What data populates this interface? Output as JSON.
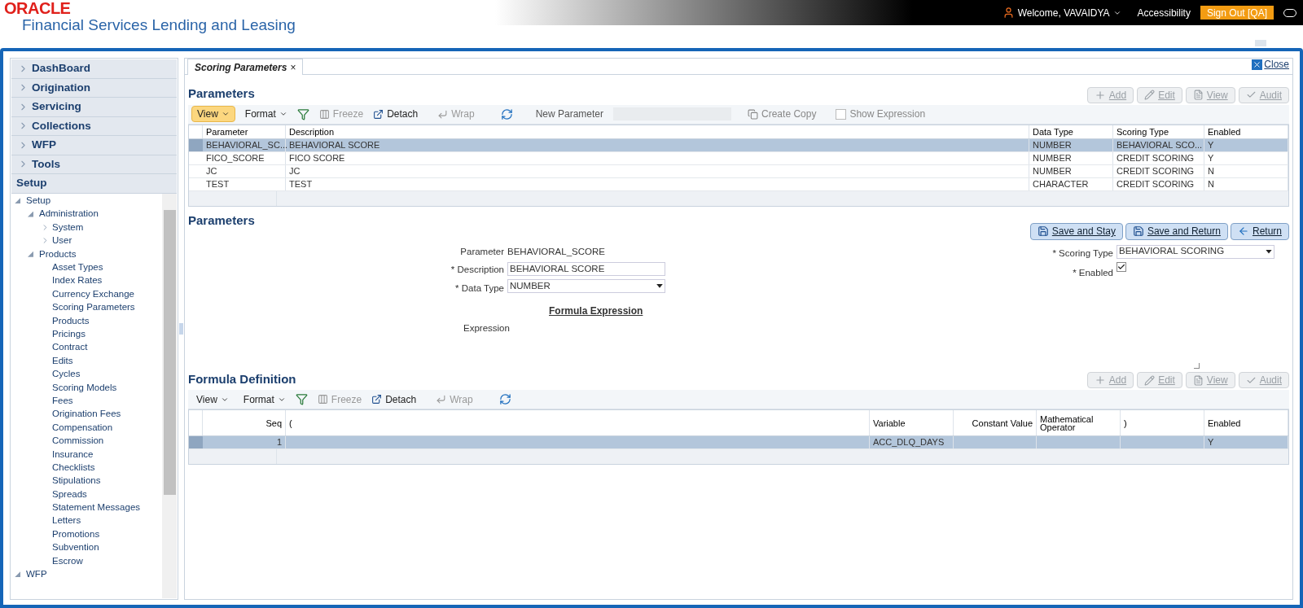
{
  "header": {
    "logo": "ORACLE",
    "product": "Financial Services Lending and Leasing",
    "welcome": "Welcome, VAVAIDYA",
    "accessibility": "Accessibility",
    "sign_out": "Sign Out [QA]"
  },
  "nav": {
    "sections": [
      {
        "label": "DashBoard",
        "expanded": false
      },
      {
        "label": "Origination",
        "expanded": false
      },
      {
        "label": "Servicing",
        "expanded": false
      },
      {
        "label": "Collections",
        "expanded": false
      },
      {
        "label": "WFP",
        "expanded": false
      },
      {
        "label": "Tools",
        "expanded": false
      },
      {
        "label": "Setup",
        "expanded": true
      }
    ],
    "tree": [
      {
        "label": "Setup",
        "expanded": true,
        "children": [
          {
            "label": "Administration",
            "expanded": true,
            "children": [
              {
                "label": "System",
                "expanded": false
              },
              {
                "label": "User",
                "expanded": false
              }
            ]
          },
          {
            "label": "Products",
            "expanded": true,
            "children": [
              {
                "label": "Asset Types"
              },
              {
                "label": "Index Rates"
              },
              {
                "label": "Currency Exchange"
              },
              {
                "label": "Scoring Parameters"
              },
              {
                "label": "Products"
              },
              {
                "label": "Pricings"
              },
              {
                "label": "Contract"
              },
              {
                "label": "Edits"
              },
              {
                "label": "Cycles"
              },
              {
                "label": "Scoring Models"
              },
              {
                "label": "Fees"
              },
              {
                "label": "Origination Fees"
              },
              {
                "label": "Compensation"
              },
              {
                "label": "Commission"
              },
              {
                "label": "Insurance"
              },
              {
                "label": "Checklists"
              },
              {
                "label": "Stipulations"
              },
              {
                "label": "Spreads"
              },
              {
                "label": "Statement Messages"
              },
              {
                "label": "Letters"
              },
              {
                "label": "Promotions"
              },
              {
                "label": "Subvention"
              },
              {
                "label": "Escrow"
              }
            ]
          }
        ]
      },
      {
        "label": "WFP",
        "expanded": true
      }
    ]
  },
  "tab": {
    "label": "Scoring Parameters",
    "close": "×"
  },
  "close": "Close",
  "parameters": {
    "title": "Parameters",
    "actions": [
      {
        "label": "Add",
        "kind": "add",
        "disabled": true
      },
      {
        "label": "Edit",
        "kind": "edit",
        "disabled": true
      },
      {
        "label": "View",
        "kind": "view",
        "disabled": true
      },
      {
        "label": "Audit",
        "kind": "audit",
        "disabled": true
      }
    ],
    "toolbar": {
      "view": "View",
      "format": "Format",
      "freeze": "Freeze",
      "detach": "Detach",
      "wrap": "Wrap",
      "new_parameter": "New Parameter",
      "create_copy": "Create Copy",
      "show_expression": "Show Expression",
      "show_expression_checked": false
    },
    "columns": [
      "Parameter",
      "Description",
      "Data Type",
      "Scoring Type",
      "Enabled"
    ],
    "rows": [
      {
        "cells": [
          "BEHAVIORAL_SC...",
          "BEHAVIORAL SCORE",
          "NUMBER",
          "BEHAVIORAL SCO...",
          "Y"
        ],
        "selected": true
      },
      {
        "cells": [
          "FICO_SCORE",
          "FICO SCORE",
          "NUMBER",
          "CREDIT SCORING",
          "Y"
        ],
        "selected": false
      },
      {
        "cells": [
          "JC",
          "JC",
          "NUMBER",
          "CREDIT SCORING",
          "N"
        ],
        "selected": false
      },
      {
        "cells": [
          "TEST",
          "TEST",
          "CHARACTER",
          "CREDIT SCORING",
          "N"
        ],
        "selected": false
      }
    ]
  },
  "detail": {
    "title": "Parameters",
    "buttons": [
      {
        "label": "Save and Stay",
        "kind": "save"
      },
      {
        "label": "Save and Return",
        "kind": "save"
      },
      {
        "label": "Return",
        "kind": "back"
      }
    ],
    "parameter_label": "Parameter",
    "parameter": "BEHAVIORAL_SCORE",
    "description_label": "* Description",
    "description": "BEHAVIORAL SCORE",
    "data_type_label": "* Data Type",
    "data_type": "NUMBER",
    "scoring_type_label": "* Scoring Type",
    "scoring_type": "BEHAVIORAL SCORING",
    "enabled_label": "* Enabled",
    "enabled": true,
    "formula_title": "Formula Expression",
    "expression_label": "Expression"
  },
  "formula": {
    "title": "Formula Definition",
    "actions": [
      {
        "label": "Add",
        "kind": "add",
        "disabled": true
      },
      {
        "label": "Edit",
        "kind": "edit",
        "disabled": true
      },
      {
        "label": "View",
        "kind": "view",
        "disabled": true
      },
      {
        "label": "Audit",
        "kind": "audit",
        "disabled": true
      }
    ],
    "toolbar": {
      "view": "View",
      "format": "Format",
      "freeze": "Freeze",
      "detach": "Detach",
      "wrap": "Wrap"
    },
    "columns": [
      "Seq",
      "(",
      "Variable",
      "Constant Value",
      "Mathematical Operator",
      ")",
      "Enabled"
    ],
    "rows": [
      {
        "cells": [
          "1",
          "",
          "ACC_DLQ_DAYS",
          "",
          "",
          "",
          "Y"
        ],
        "selected": true
      }
    ]
  }
}
